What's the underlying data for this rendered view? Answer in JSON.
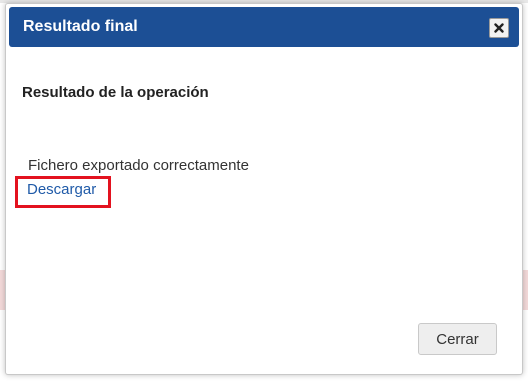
{
  "dialog": {
    "title": "Resultado final",
    "heading": "Resultado de la operación",
    "message": "Fichero exportado correctamente",
    "download_label": "Descargar",
    "close_button_label": "Cerrar"
  },
  "colors": {
    "titlebar": "#1c4f95",
    "link": "#1f5aa8",
    "highlight_border": "#e3121f"
  },
  "icons": {
    "close": "close-icon"
  }
}
